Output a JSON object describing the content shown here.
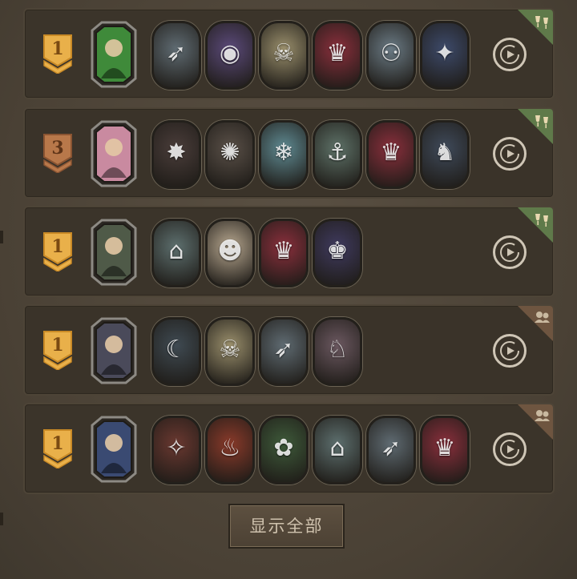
{
  "footer": {
    "show_all_label": "显示全部"
  },
  "colors": {
    "gold_badge": "#e9b04a",
    "bronze_badge": "#b8784a",
    "corner_green": "#5f7a4a",
    "corner_brown": "#6e5540"
  },
  "records": [
    {
      "rank": "1",
      "badge": "gold",
      "corner": "wine-glasses-icon",
      "hero": {
        "name": "plant-haired-hero-portrait",
        "color": "#3f8a3a"
      },
      "units": [
        {
          "name": "missile-cart-unit",
          "color": "#5f6b72",
          "glyph": "➶"
        },
        {
          "name": "owl-sorcerer-unit",
          "color": "#5b4a7a",
          "glyph": "◉"
        },
        {
          "name": "bone-dragon-unit",
          "color": "#9a8f6c",
          "glyph": "☠"
        },
        {
          "name": "jester-clown-unit",
          "color": "#8a2f3c",
          "glyph": "♛"
        },
        {
          "name": "bat-beast-unit",
          "color": "#6a7a84",
          "glyph": "⚇"
        },
        {
          "name": "rat-bandit-unit",
          "color": "#3d4a6a",
          "glyph": "✦"
        }
      ]
    },
    {
      "rank": "3",
      "badge": "bronze",
      "corner": "wine-glasses-icon",
      "hero": {
        "name": "blonde-mage-hero-portrait",
        "color": "#c98aa0"
      },
      "units": [
        {
          "name": "fire-bear-unit",
          "color": "#4a3d3a",
          "glyph": "✸"
        },
        {
          "name": "hedgehog-rogue-unit",
          "color": "#5a5048",
          "glyph": "✺"
        },
        {
          "name": "ice-fairy-unit",
          "color": "#5f8a92",
          "glyph": "❄"
        },
        {
          "name": "kraken-ship-unit",
          "color": "#5e7268",
          "glyph": "⚓"
        },
        {
          "name": "jester-clown-unit",
          "color": "#8a2f3c",
          "glyph": "♛"
        },
        {
          "name": "stone-boar-unit",
          "color": "#3f4a5a",
          "glyph": "♞"
        }
      ]
    },
    {
      "rank": "1",
      "badge": "gold",
      "corner": "wine-glasses-icon",
      "hero": {
        "name": "hooded-assassin-hero-portrait",
        "color": "#4f5a48"
      },
      "units": [
        {
          "name": "bell-turret-unit",
          "color": "#5d6f6e",
          "glyph": "⌂"
        },
        {
          "name": "pumpkin-ghost-unit",
          "color": "#b8a890",
          "glyph": "☻"
        },
        {
          "name": "jester-clown-unit",
          "color": "#8a2f3c",
          "glyph": "♛"
        },
        {
          "name": "pumpkin-king-unit",
          "color": "#3f3a5e",
          "glyph": "♚"
        }
      ]
    },
    {
      "rank": "1",
      "badge": "gold",
      "corner": "people-icon",
      "hero": {
        "name": "witch-hat-hero-portrait",
        "color": "#4a4a5a"
      },
      "units": [
        {
          "name": "shadow-panther-unit",
          "color": "#3f4a52",
          "glyph": "☾"
        },
        {
          "name": "bone-dragon-unit",
          "color": "#9a8f6c",
          "glyph": "☠"
        },
        {
          "name": "missile-cart-unit",
          "color": "#5f6b72",
          "glyph": "➶"
        },
        {
          "name": "rabbit-knight-unit",
          "color": "#6b5860",
          "glyph": "♘"
        }
      ]
    },
    {
      "rank": "1",
      "badge": "gold",
      "corner": "people-icon",
      "hero": {
        "name": "spectacled-scholar-hero-portrait",
        "color": "#3a4a72"
      },
      "units": [
        {
          "name": "red-ninja-unit",
          "color": "#6a3830",
          "glyph": "✧"
        },
        {
          "name": "fire-tank-unit",
          "color": "#8a3a2a",
          "glyph": "♨"
        },
        {
          "name": "thorn-dryad-unit",
          "color": "#3e5a3a",
          "glyph": "✿"
        },
        {
          "name": "bell-turret-unit",
          "color": "#5d6f6e",
          "glyph": "⌂"
        },
        {
          "name": "missile-cart-unit",
          "color": "#5f6b72",
          "glyph": "➶"
        },
        {
          "name": "jester-clown-unit",
          "color": "#8a2f3c",
          "glyph": "♛"
        }
      ]
    }
  ]
}
